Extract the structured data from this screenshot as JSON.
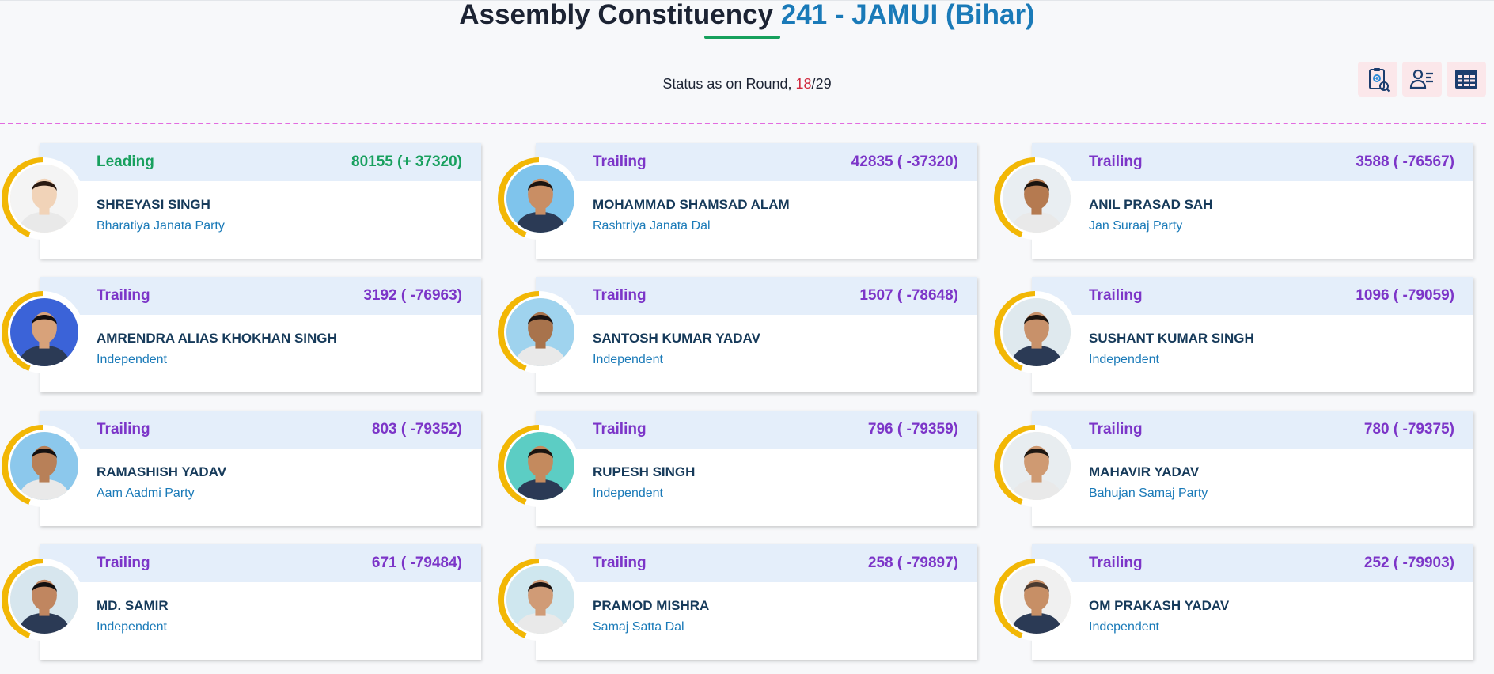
{
  "header": {
    "title_prefix": "Assembly Constituency",
    "constituency": "241 - JAMUI",
    "state": "(Bihar)"
  },
  "status": {
    "label": "Status as on Round,",
    "current_round": "18",
    "separator": "/",
    "total_rounds": "29"
  },
  "toolbar": {
    "icons": [
      "report-icon",
      "candidate-list-icon",
      "table-view-icon"
    ]
  },
  "colors": {
    "leading": "#18a05e",
    "trailing": "#7c35c8",
    "party": "#1a7ab8",
    "ring": "#f2b705"
  },
  "candidates": [
    {
      "status": "Leading",
      "votes": "80155 (+ 37320)",
      "name": "SHREYASI SINGH",
      "party": "Bharatiya Janata Party"
    },
    {
      "status": "Trailing",
      "votes": "42835 ( -37320)",
      "name": "MOHAMMAD SHAMSAD ALAM",
      "party": "Rashtriya Janata Dal"
    },
    {
      "status": "Trailing",
      "votes": "3588 ( -76567)",
      "name": "ANIL PRASAD SAH",
      "party": "Jan Suraaj Party"
    },
    {
      "status": "Trailing",
      "votes": "3192 ( -76963)",
      "name": "AMRENDRA ALIAS KHOKHAN SINGH",
      "party": "Independent"
    },
    {
      "status": "Trailing",
      "votes": "1507 ( -78648)",
      "name": "SANTOSH KUMAR YADAV",
      "party": "Independent"
    },
    {
      "status": "Trailing",
      "votes": "1096 ( -79059)",
      "name": "SUSHANT KUMAR SINGH",
      "party": "Independent"
    },
    {
      "status": "Trailing",
      "votes": "803 ( -79352)",
      "name": "RAMASHISH YADAV",
      "party": "Aam Aadmi Party"
    },
    {
      "status": "Trailing",
      "votes": "796 ( -79359)",
      "name": "RUPESH SINGH",
      "party": "Independent"
    },
    {
      "status": "Trailing",
      "votes": "780 ( -79375)",
      "name": "MAHAVIR YADAV",
      "party": "Bahujan Samaj Party"
    },
    {
      "status": "Trailing",
      "votes": "671 ( -79484)",
      "name": "MD. SAMIR",
      "party": "Independent"
    },
    {
      "status": "Trailing",
      "votes": "258 ( -79897)",
      "name": "PRAMOD MISHRA",
      "party": "Samaj Satta Dal"
    },
    {
      "status": "Trailing",
      "votes": "252 ( -79903)",
      "name": "OM PRAKASH YADAV",
      "party": "Independent"
    }
  ]
}
